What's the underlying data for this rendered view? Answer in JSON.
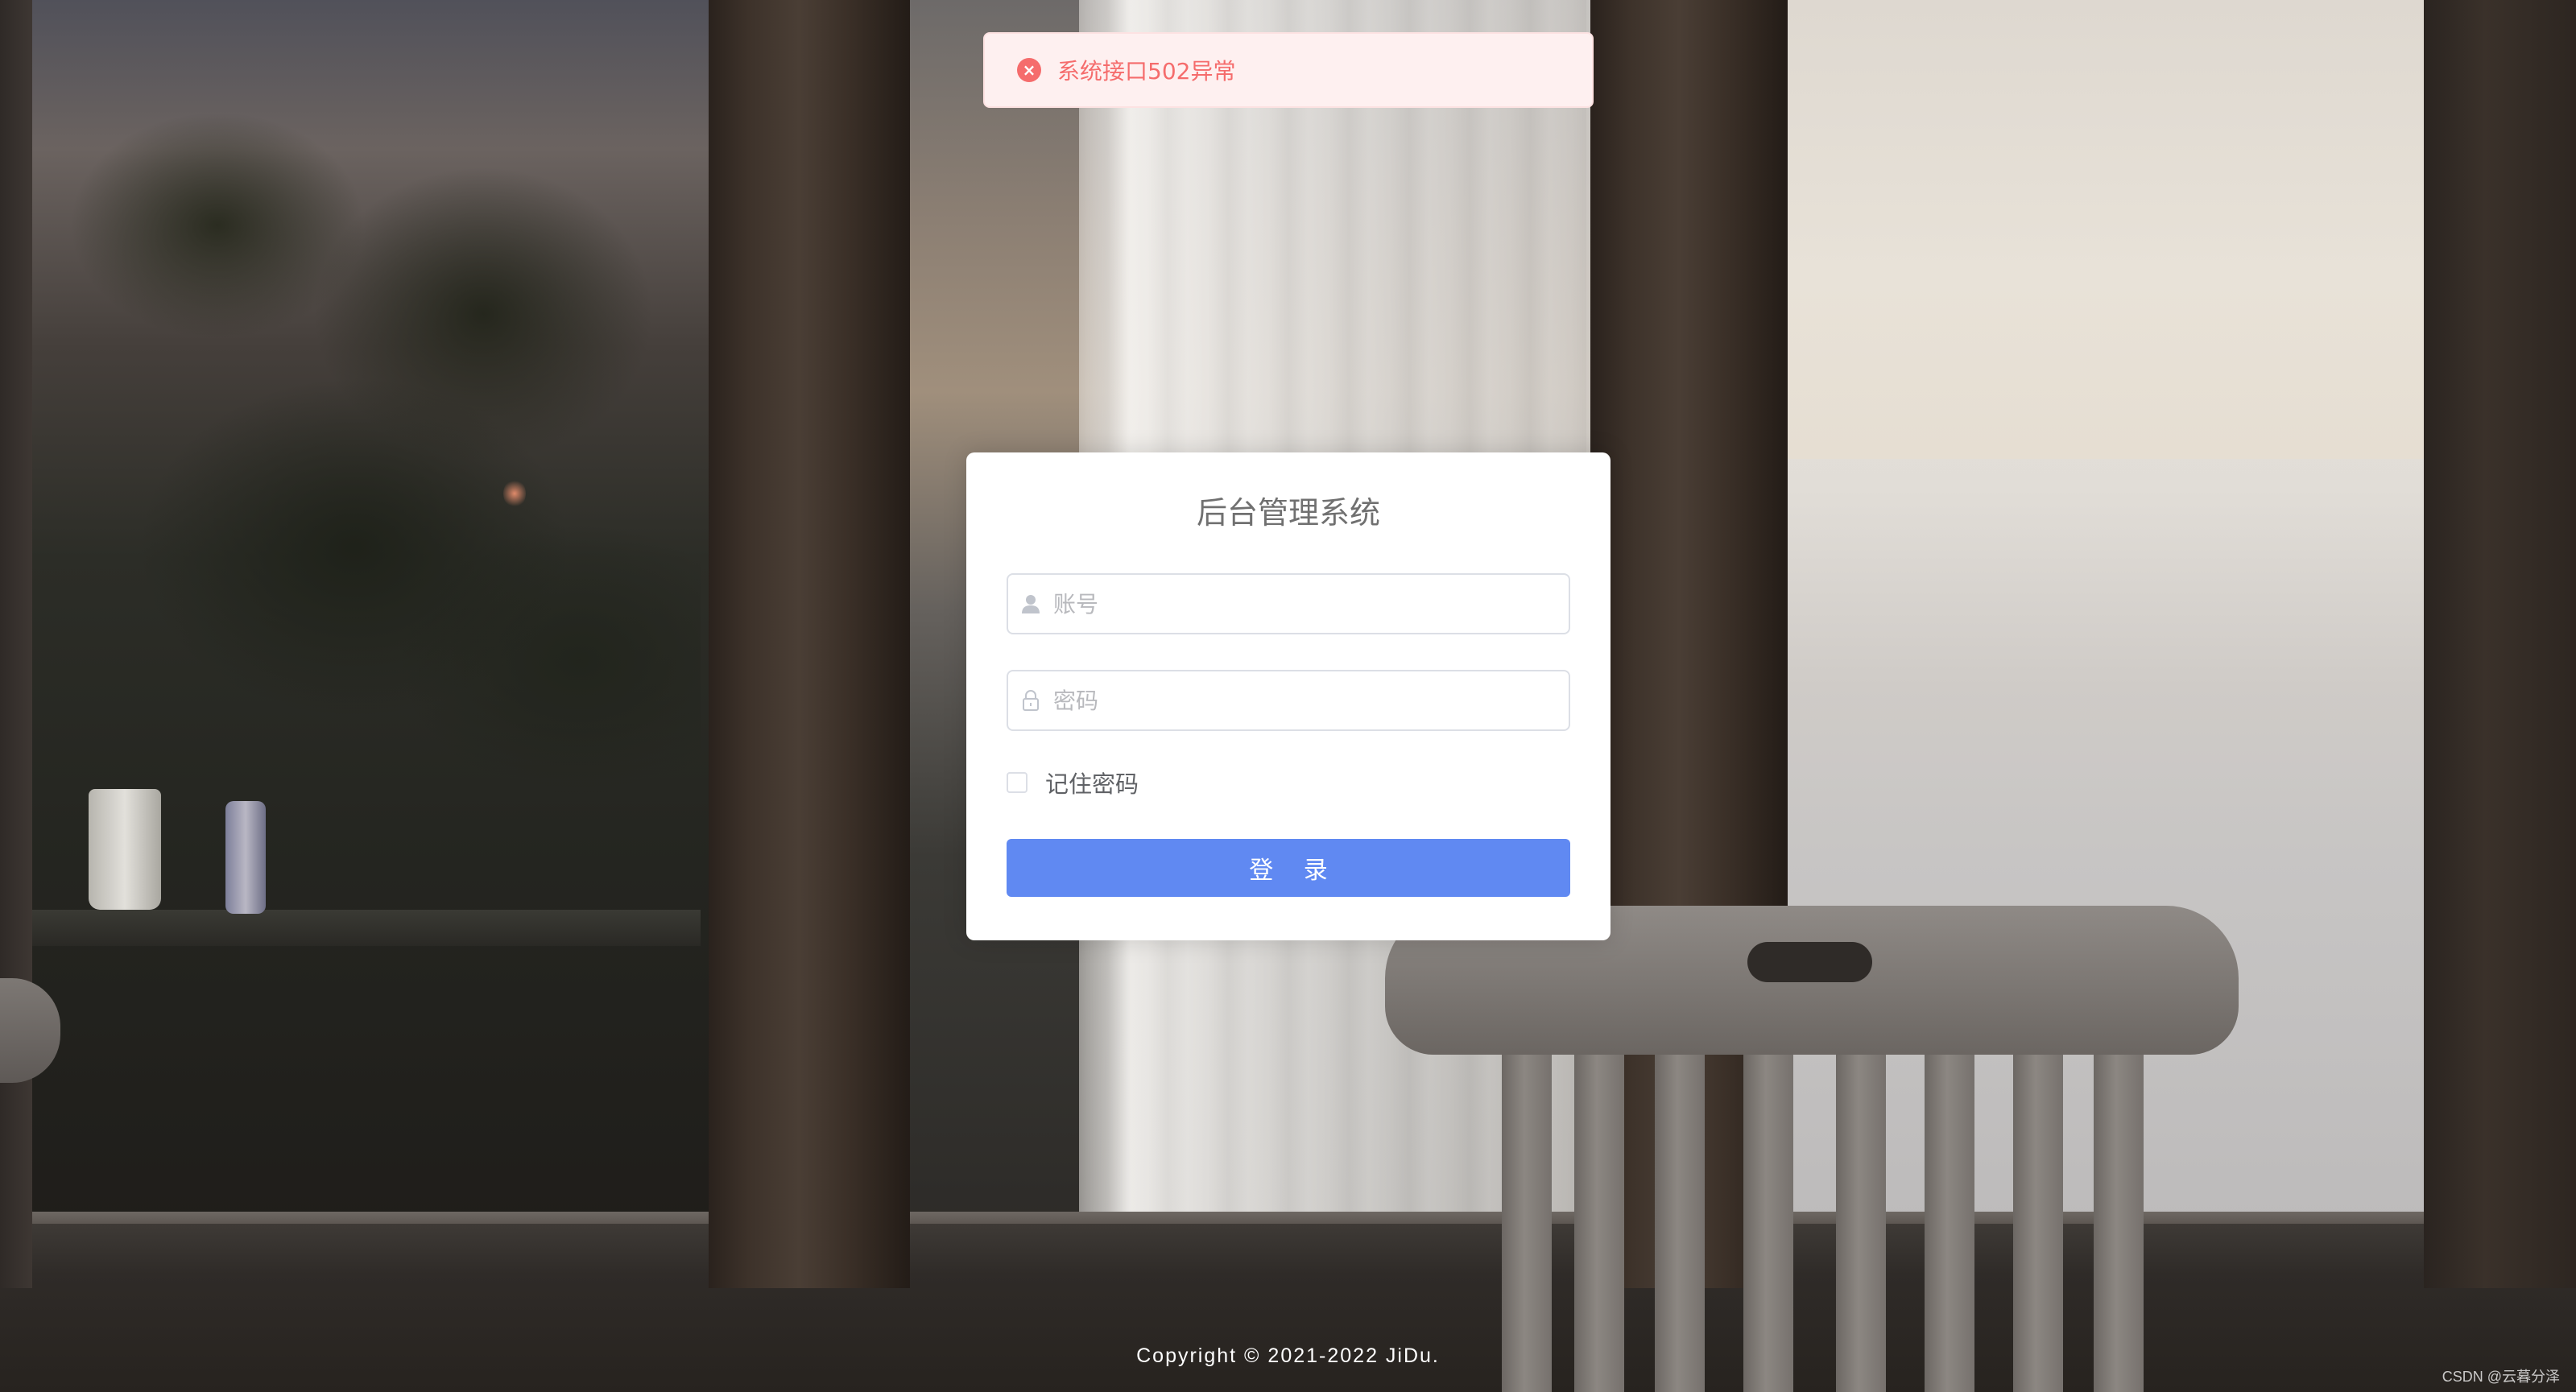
{
  "message": {
    "type": "error",
    "icon": "circle-close-icon",
    "icon_glyph": "×",
    "text": "系统接口502异常"
  },
  "login": {
    "title": "后台管理系统",
    "username": {
      "icon": "user-icon",
      "value": "",
      "placeholder": "账号"
    },
    "password": {
      "icon": "lock-icon",
      "value": "",
      "placeholder": "密码"
    },
    "remember": {
      "label": "记住密码",
      "checked": false
    },
    "submit_label": "登 录"
  },
  "footer": {
    "copyright": "Copyright © 2021-2022 JiDu.",
    "watermark": "CSDN @云暮分泽"
  },
  "colors": {
    "error": "#f56c6c",
    "error_bg": "#fef0f0",
    "primary": "#6089f2",
    "border": "#dcdfe6"
  }
}
